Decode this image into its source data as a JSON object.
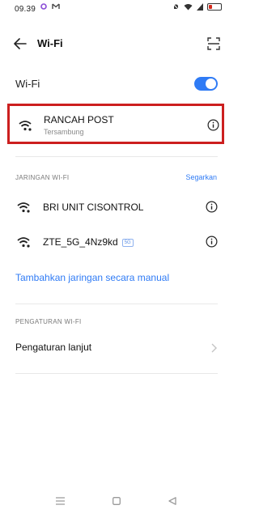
{
  "status_bar": {
    "time": "09.39",
    "left_icons": [
      "notification-dot-icon",
      "gmail-icon"
    ],
    "right_icons": [
      "alarm-off-icon",
      "wifi-status-icon",
      "battery-icon"
    ],
    "battery_color": "#d52b1e"
  },
  "header": {
    "title": "Wi-Fi",
    "back_icon": "back-arrow-icon",
    "scan_icon": "qr-scan-icon"
  },
  "wifi_toggle": {
    "label": "Wi-Fi",
    "state": "on",
    "accent": "#2f7bf5"
  },
  "connected_network": {
    "name": "RANCAH POST",
    "status": "Tersambung",
    "highlight_color": "#cc1f1f"
  },
  "networks_section": {
    "label": "JARINGAN WI-FI",
    "refresh_label": "Segarkan",
    "items": [
      {
        "name": "BRI UNIT CISONTROL",
        "badge": ""
      },
      {
        "name": "ZTE_5G_4Nz9kd",
        "badge": "5G"
      }
    ],
    "add_network_label": "Tambahkan jaringan secara manual"
  },
  "settings_section": {
    "label": "PENGATURAN WI-FI",
    "advanced_label": "Pengaturan lanjut"
  },
  "nav_bar": {
    "icons": [
      "menu-icon",
      "home-icon",
      "back-icon"
    ]
  }
}
